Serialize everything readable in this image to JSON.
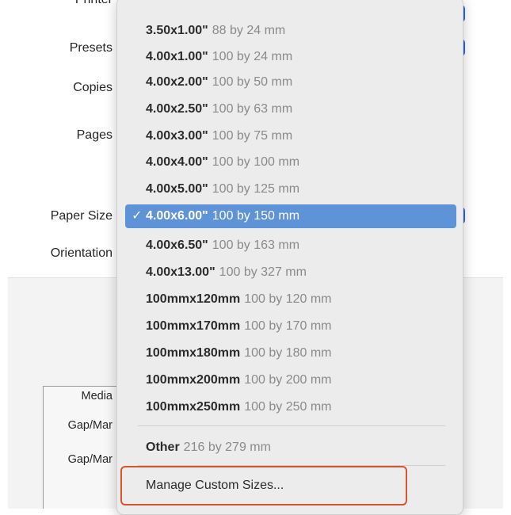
{
  "dialog": {
    "labels": {
      "printer": "Printer",
      "presets": "Presets",
      "copies": "Copies",
      "pages": "Pages",
      "paper_size": "Paper Size",
      "orientation": "Orientation",
      "media": "Media",
      "gap1": "Gap/Mar",
      "gap2": "Gap/Mar"
    },
    "accent_color": "#2f64d8"
  },
  "paper_size_menu": {
    "items": [
      {
        "name": "3.50x1.00\"",
        "desc": "88 by 24 mm"
      },
      {
        "name": "4.00x1.00\"",
        "desc": "100 by 24 mm"
      },
      {
        "name": "4.00x2.00\"",
        "desc": "100 by 50 mm"
      },
      {
        "name": "4.00x2.50\"",
        "desc": "100 by 63 mm"
      },
      {
        "name": "4.00x3.00\"",
        "desc": "100 by 75 mm"
      },
      {
        "name": "4.00x4.00\"",
        "desc": "100 by 100 mm"
      },
      {
        "name": "4.00x5.00\"",
        "desc": "100 by 125 mm"
      },
      {
        "name": "4.00x6.00\"",
        "desc": "100 by 150 mm",
        "selected": true
      },
      {
        "name": "4.00x6.50\"",
        "desc": "100 by 163 mm"
      },
      {
        "name": "4.00x13.00\"",
        "desc": "100 by 327 mm"
      },
      {
        "name": "100mmx120mm",
        "desc": "100 by 120 mm"
      },
      {
        "name": "100mmx170mm",
        "desc": "100 by 170 mm"
      },
      {
        "name": "100mmx180mm",
        "desc": "100 by 180 mm"
      },
      {
        "name": "100mmx200mm",
        "desc": "100 by 200 mm"
      },
      {
        "name": "100mmx250mm",
        "desc": "100 by 250 mm"
      }
    ],
    "other": {
      "name": "Other",
      "desc": "216 by 279 mm"
    },
    "manage_label": "Manage Custom Sizes...",
    "check_mark": "✓",
    "selected_color": "#5f93d8",
    "highlight_border_color": "#d9532f"
  }
}
